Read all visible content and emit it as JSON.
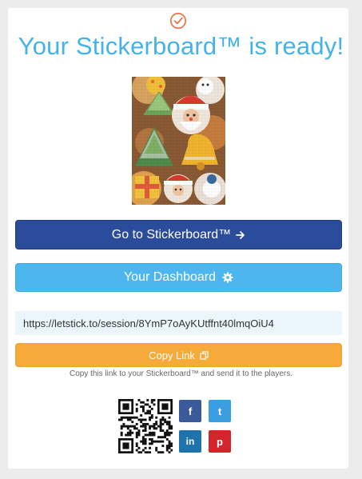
{
  "header": {
    "title": "Your Stickerboard™ is ready!",
    "check_color": "#ee6a3c",
    "title_color": "#46b3e8"
  },
  "preview": {
    "icon": "stickerboard-preview-image"
  },
  "actions": {
    "go_label": "Go to Stickerboard™",
    "go_icon": "arrow-right-icon",
    "dashboard_label": "Your Dashboard",
    "dashboard_icon": "gear-icon",
    "copy_label": "Copy Link",
    "copy_icon": "copy-icon"
  },
  "share": {
    "url": "https://letstick.to/session/8YmP7oAyKUtffnt40lmqOiU4",
    "help_text": "Copy this link to your Stickerboard™ and send it to the players.",
    "social": [
      {
        "name": "facebook",
        "glyph": "f",
        "color": "#3b5a9a"
      },
      {
        "name": "twitter",
        "glyph": "t",
        "color": "#3b9ee3"
      },
      {
        "name": "linkedin",
        "glyph": "in",
        "color": "#1f73ad"
      },
      {
        "name": "pinterest",
        "glyph": "p",
        "color": "#d3262b"
      }
    ]
  },
  "colors": {
    "primary": "#2a4c9b",
    "dashboard": "#4db6ee",
    "copy": "#f5aa3a"
  }
}
